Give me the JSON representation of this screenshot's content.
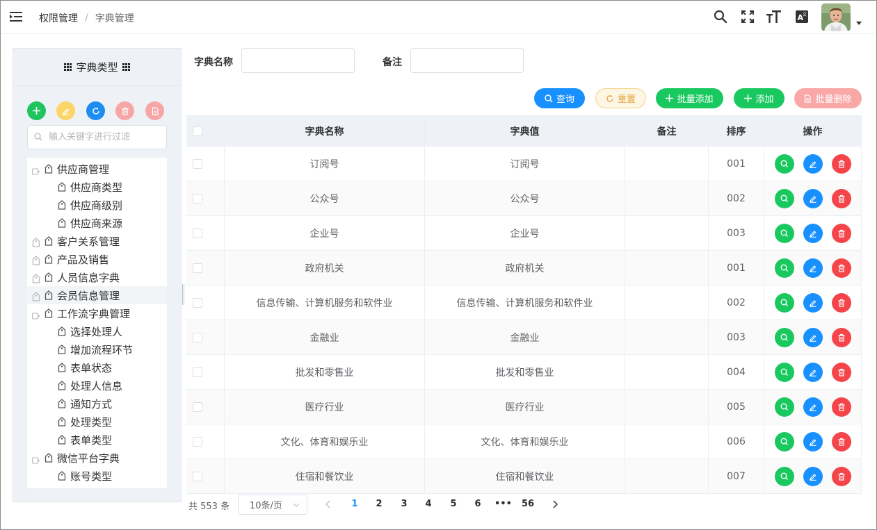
{
  "header": {
    "breadcrumb": [
      "权限管理",
      "字典管理"
    ],
    "icons": [
      "menu-fold-icon",
      "search-icon",
      "fullscreen-icon",
      "font-size-icon",
      "translate-icon"
    ]
  },
  "left_panel": {
    "title": "字典类型",
    "toolbar": [
      {
        "name": "add",
        "color": "#1fc45f"
      },
      {
        "name": "edit",
        "color": "#fcd567"
      },
      {
        "name": "refresh",
        "color": "#1d8ef0"
      },
      {
        "name": "delete",
        "color": "#f7a6a6"
      },
      {
        "name": "export",
        "color": "#f7a6a6"
      }
    ],
    "filter_placeholder": "输入关键字进行过滤",
    "tree": [
      {
        "label": "供应商管理",
        "level": 0,
        "expandable": true
      },
      {
        "label": "供应商类型",
        "level": 1
      },
      {
        "label": "供应商级别",
        "level": 1
      },
      {
        "label": "供应商来源",
        "level": 1
      },
      {
        "label": "客户关系管理",
        "level": 0,
        "expandable": false
      },
      {
        "label": "产品及销售",
        "level": 0,
        "expandable": false
      },
      {
        "label": "人员信息字典",
        "level": 0,
        "expandable": false
      },
      {
        "label": "会员信息管理",
        "level": 0,
        "expandable": false,
        "active": true
      },
      {
        "label": "工作流字典管理",
        "level": 0,
        "expandable": true
      },
      {
        "label": "选择处理人",
        "level": 1
      },
      {
        "label": "增加流程环节",
        "level": 1
      },
      {
        "label": "表单状态",
        "level": 1
      },
      {
        "label": "处理人信息",
        "level": 1
      },
      {
        "label": "通知方式",
        "level": 1
      },
      {
        "label": "处理类型",
        "level": 1
      },
      {
        "label": "表单类型",
        "level": 1
      },
      {
        "label": "微信平台字典",
        "level": 0,
        "expandable": true
      },
      {
        "label": "账号类型",
        "level": 1
      }
    ]
  },
  "search": {
    "name_label": "字典名称",
    "remark_label": "备注",
    "name_value": "",
    "remark_value": ""
  },
  "actions": {
    "query": "查询",
    "reset": "重置",
    "batch_add": "批量添加",
    "add": "添加",
    "batch_delete": "批量删除"
  },
  "table": {
    "columns": [
      "字典名称",
      "字典值",
      "备注",
      "排序",
      "操作"
    ],
    "rows": [
      {
        "name": "订阅号",
        "value": "订阅号",
        "remark": "",
        "sort": "001"
      },
      {
        "name": "公众号",
        "value": "公众号",
        "remark": "",
        "sort": "002"
      },
      {
        "name": "企业号",
        "value": "企业号",
        "remark": "",
        "sort": "003"
      },
      {
        "name": "政府机关",
        "value": "政府机关",
        "remark": "",
        "sort": "001"
      },
      {
        "name": "信息传输、计算机服务和软件业",
        "value": "信息传输、计算机服务和软件业",
        "remark": "",
        "sort": "002"
      },
      {
        "name": "金融业",
        "value": "金融业",
        "remark": "",
        "sort": "003"
      },
      {
        "name": "批发和零售业",
        "value": "批发和零售业",
        "remark": "",
        "sort": "004"
      },
      {
        "name": "医疗行业",
        "value": "医疗行业",
        "remark": "",
        "sort": "005"
      },
      {
        "name": "文化、体育和娱乐业",
        "value": "文化、体育和娱乐业",
        "remark": "",
        "sort": "006"
      },
      {
        "name": "住宿和餐饮业",
        "value": "住宿和餐饮业",
        "remark": "",
        "sort": "007"
      }
    ]
  },
  "pagination": {
    "total": "共 553 条",
    "page_size": "10条/页",
    "pages": [
      "1",
      "2",
      "3",
      "4",
      "5",
      "6",
      "•••",
      "56"
    ],
    "current": "1"
  }
}
